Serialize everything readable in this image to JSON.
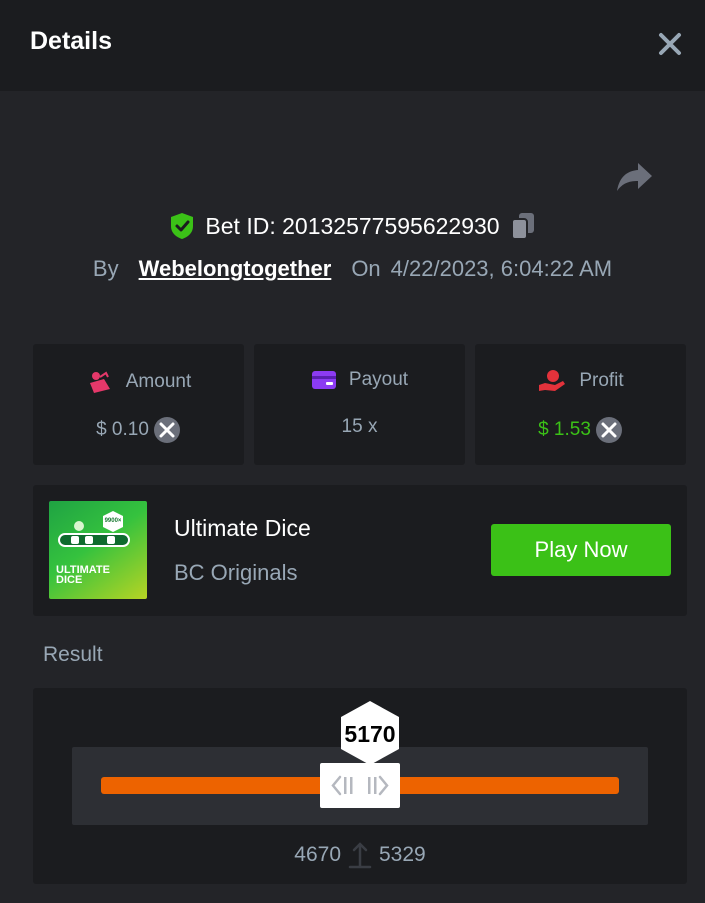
{
  "header": {
    "title": "Details"
  },
  "bet": {
    "id_label": "Bet ID: 20132577595622930",
    "by_label": "By",
    "username": "Webelongtogether",
    "on_label": "On",
    "date": "4/22/2023, 6:04:22 AM"
  },
  "stats": {
    "amount": {
      "label": "Amount",
      "value": "$ 0.10"
    },
    "payout": {
      "label": "Payout",
      "value": "15 x"
    },
    "profit": {
      "label": "Profit",
      "value": "$ 1.53"
    }
  },
  "game": {
    "name": "Ultimate Dice",
    "provider": "BC Originals",
    "play_label": "Play Now",
    "thumb_line1": "ULTIMATE",
    "thumb_line2": "DICE",
    "thumb_badge": "9900×"
  },
  "result": {
    "label": "Result",
    "value": "5170",
    "range_low": "4670",
    "range_high": "5329"
  },
  "colors": {
    "accent_green": "#3bc117",
    "accent_orange": "#ed6300",
    "shield_green": "#3bc117",
    "amount_icon": "#e5386a",
    "payout_icon": "#8c3bf2",
    "profit_icon": "#e3323b"
  },
  "icons": [
    "close-icon",
    "share-icon",
    "shield-check-icon",
    "copy-icon",
    "amount-icon",
    "payout-card-icon",
    "profit-hand-icon",
    "coin-icon",
    "arrow-up-icon"
  ]
}
